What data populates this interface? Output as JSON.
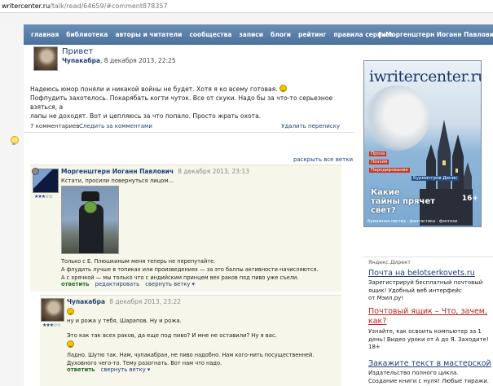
{
  "address_bar": {
    "domain": "writercenter.ru",
    "path": "/talk/read/64659/#comment878357"
  },
  "nav": {
    "items": [
      "главная",
      "библиотека",
      "авторы и читатели",
      "сообщества",
      "записи",
      "блоги",
      "рейтинг",
      "правила сервиса"
    ],
    "user_name": "Моргенштерн Иоганн Павлович"
  },
  "post": {
    "title": "Привет",
    "author": "Чупакабра",
    "date": ", 8 декабря 2013, 22:25",
    "body_line1": "Надеюсь юмор поняли и никакой войны не будет. Хотя я ко всему готовая.",
    "body_line2": "Пофпудить захотелось. Покарябать когти чуток. Все от скуки. Надо бы за что-то серьезное взяться, а",
    "body_line3": "лапы не доходят. Вот и цепляюсь за что попало. Просто жрать охота.",
    "comments_count": "7 комментариев",
    "follow_comments": "Следить за комментами",
    "delete_post": "Удалить переписку"
  },
  "expand_all": "раскрыть все ветки",
  "comment1": {
    "author": "Моргенштерн Иоганн Павлович",
    "date": "8 декабря 2013, 23:13",
    "stars": "★★★☆☆",
    "text1": "Кстати, просили повернуться лицом...",
    "text2": "Только с Е. Плюшкиным меня теперь не перепутайте.",
    "text3": "А флудить лучше в топиках или произведениях — за это баллы активности начисляются.",
    "text4": "А с хрячкой — мы только что с индийским принцем вех раков под пиво уже съели.",
    "reply": "ответить",
    "edit": "редактировать",
    "collapse": "свернуть ветку ▾"
  },
  "comment2": {
    "author": "Чупакабра",
    "date": "8 декабря 2013, 23:22",
    "stars": "★★★☆☆",
    "line1": "ну и рожа у тебя, Шарапов. Ну и рожа.",
    "line2": "Это как так всех раков, да еще под пиво? И мне не оставили? Ну я вас.",
    "text3": "Ладно. Шутю так. Нам, чупакабран, не пиво надобно. Нам кого-нить посущественней.",
    "text4": "Духовного чего-то. Тему разогнать. Вот нам что надо.",
    "reply": "ответить",
    "collapse": "свернуть ветку ▾"
  },
  "magazine": {
    "logo_left": "i",
    "logo_main": "writercenter",
    "logo_dot": ".",
    "logo_tld": "ru",
    "tag1": "Проза",
    "tag2": "Поэзия",
    "tag3": "Пародирование",
    "tag4": "Бурмистров Денис",
    "headline1": "Какие",
    "headline2": "тайны прячет",
    "headline3": "свет?",
    "age": "16+",
    "footer": "Бумажная листва · фантастика · фэнтези"
  },
  "ads": {
    "header": "Яндекс.Директ",
    "ad1_title": "Почта на belotserkovets.ru",
    "ad1_line1": "Зарегистрируй бесплатный почтовый",
    "ad1_line2": "ящик! Удобный веб интерфейс",
    "ad1_line3": "от Мэил.ру!",
    "ad2_title1": "Почтовый ящик – Что, зачем,",
    "ad2_title2": "как?",
    "ad2_line1": "Узнайте, как освоить компьютер за 1",
    "ad2_line2": "день! Видео уроки от А до Я. Заходите!",
    "ad2_line3": "18+",
    "ad3_title": "Закажите текст в мастерской",
    "ad3_line1": "Издательство полного цикла.",
    "ad3_line2": "Создание книги с нуля! Любые тиражи."
  }
}
